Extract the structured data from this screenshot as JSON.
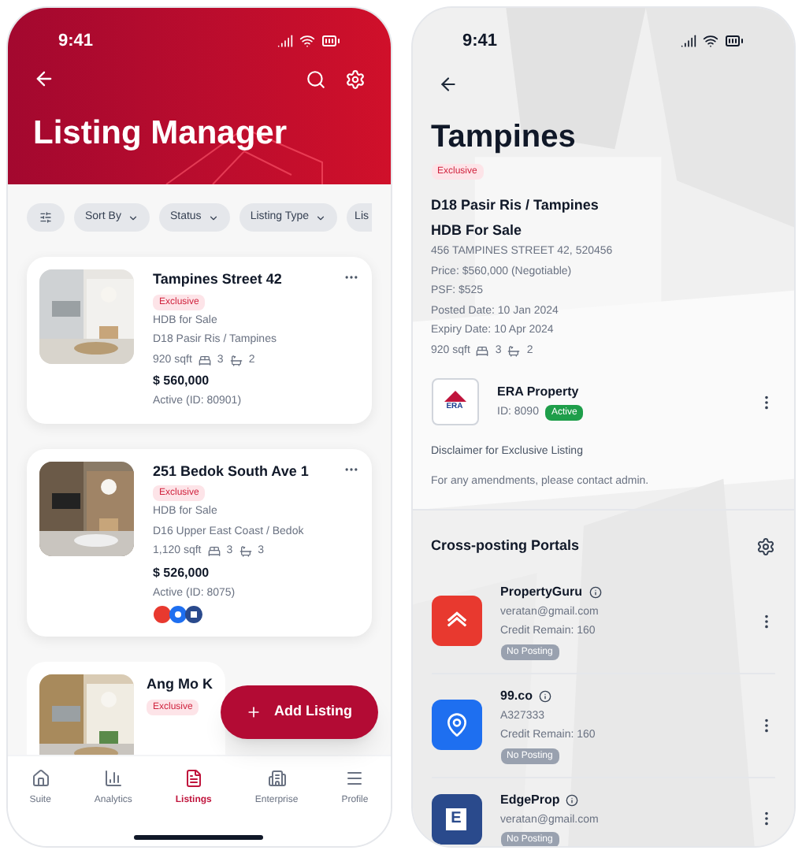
{
  "left": {
    "status_time": "9:41",
    "title": "Listing Manager",
    "filters": [
      {
        "kind": "icon"
      },
      {
        "kind": "dropdown",
        "label": "Sort By"
      },
      {
        "kind": "dropdown",
        "label": "Status"
      },
      {
        "kind": "dropdown",
        "label": "Listing Type"
      },
      {
        "kind": "partial",
        "label": "Lis"
      }
    ],
    "listings": [
      {
        "title": "Tampines Street 42",
        "tag": "Exclusive",
        "type": "HDB for Sale",
        "district": "D18 Pasir Ris / Tampines",
        "sqft": "920 sqft",
        "beds": "3",
        "baths": "2",
        "price": "$ 560,000",
        "status": "Active (ID: 80901)",
        "portals": false
      },
      {
        "title": "251 Bedok South Ave 1",
        "tag": "Exclusive",
        "type": "HDB for Sale",
        "district": "D16 Upper East Coast / Bedok",
        "sqft": "1,120 sqft",
        "beds": "3",
        "baths": "3",
        "price": "$ 526,000",
        "status": "Active (ID: 8075)",
        "portals": true
      }
    ],
    "partial_listing": {
      "title": "Ang Mo K",
      "tag": "Exclusive"
    },
    "add_button": "Add Listing",
    "nav": [
      {
        "label": "Suite",
        "selected": false
      },
      {
        "label": "Analytics",
        "selected": false
      },
      {
        "label": "Listings",
        "selected": true
      },
      {
        "label": "Enterprise",
        "selected": false
      },
      {
        "label": "Profile",
        "selected": false
      }
    ]
  },
  "right": {
    "status_time": "9:41",
    "title": "Tampines",
    "tag": "Exclusive",
    "district": "D18 Pasir Ris / Tampines",
    "type": "HDB For Sale",
    "address": "456 TAMPINES STREET 42, 520456",
    "price": "Price: $560,000 (Negotiable)",
    "psf": "PSF: $525",
    "posted": "Posted Date: 10 Jan 2024",
    "expiry": "Expiry Date: 10 Apr 2024",
    "sqft": "920 sqft",
    "beds": "3",
    "baths": "2",
    "agency": {
      "logo": "ERA",
      "name": "ERA Property",
      "id": "ID: 8090",
      "status": "Active"
    },
    "disclaimer_title": "Disclaimer for Exclusive Listing",
    "disclaimer_text": "For any amendments, please contact admin.",
    "portals_title": "Cross-posting Portals",
    "portals": [
      {
        "name": "PropertyGuru",
        "account": "veratan@gmail.com",
        "credit": "Credit Remain: 160",
        "badge": "No Posting",
        "color": "#e8392f",
        "kind": "house"
      },
      {
        "name": "99.co",
        "account": "A327333",
        "credit": "Credit Remain: 160",
        "badge": "No Posting",
        "color": "#1e6ff0",
        "kind": "pin"
      },
      {
        "name": "EdgeProp",
        "account": "veratan@gmail.com",
        "badge": "No Posting",
        "color": "#2a4a8c",
        "kind": "letter",
        "letter": "E"
      }
    ]
  }
}
